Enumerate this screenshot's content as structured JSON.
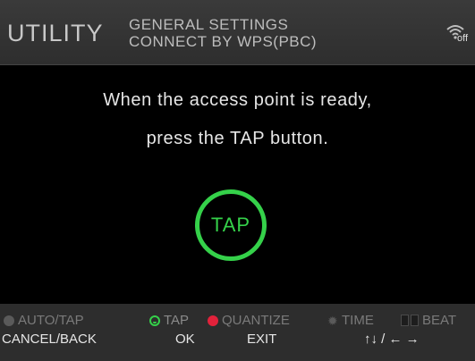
{
  "header": {
    "title": "UTILITY",
    "subtitle_line1": "GENERAL SETTINGS",
    "subtitle_line2": "CONNECT BY WPS(PBC)",
    "wifi_icon": "wifi-off-icon",
    "wifi_status": "off"
  },
  "main": {
    "message_line1": "When the access point is ready,",
    "message_line2": "press the TAP button.",
    "tap_label": "TAP",
    "accent_color": "#35d14a"
  },
  "footer": {
    "indicators": {
      "auto_tap": "AUTO/TAP",
      "tap": "TAP",
      "quantize": "QUANTIZE",
      "time": "TIME",
      "beat": "BEAT"
    },
    "actions": {
      "cancel_back": "CANCEL/BACK",
      "ok": "OK",
      "exit": "EXIT",
      "navigate": "↑↓ / ← →"
    },
    "colors": {
      "auto_tap_dot": "#5a5a5a",
      "tap_icon": "#35d14a",
      "quantize_dot": "#e2223b"
    }
  }
}
